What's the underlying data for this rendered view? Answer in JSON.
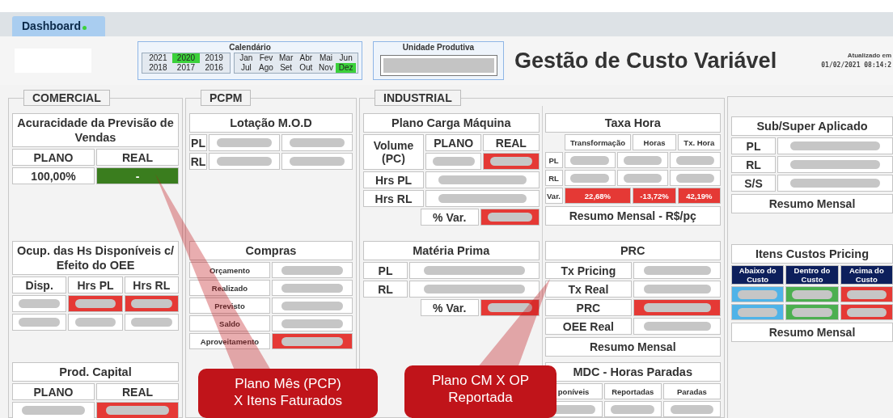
{
  "tab": {
    "label": "Dashboard",
    "selected": true
  },
  "calendar": {
    "title": "Calendário",
    "years": [
      {
        "label": "2021",
        "selected": false
      },
      {
        "label": "2020",
        "selected": true
      },
      {
        "label": "2019",
        "selected": false
      },
      {
        "label": "2018",
        "selected": false
      },
      {
        "label": "2017",
        "selected": false
      },
      {
        "label": "2016",
        "selected": false
      }
    ],
    "months": [
      {
        "label": "Jan",
        "selected": false
      },
      {
        "label": "Fev",
        "selected": false
      },
      {
        "label": "Mar",
        "selected": false
      },
      {
        "label": "Abr",
        "selected": false
      },
      {
        "label": "Mai",
        "selected": false
      },
      {
        "label": "Jun",
        "selected": false
      },
      {
        "label": "Jul",
        "selected": false
      },
      {
        "label": "Ago",
        "selected": false
      },
      {
        "label": "Set",
        "selected": false
      },
      {
        "label": "Out",
        "selected": false
      },
      {
        "label": "Nov",
        "selected": false
      },
      {
        "label": "Dez",
        "selected": true
      }
    ]
  },
  "unit": {
    "title": "Unidade Produtiva"
  },
  "title": "Gestão de Custo Variável",
  "updated": {
    "label": "Atualizado em",
    "value": "01/02/2021 08:14:2"
  },
  "sections": [
    {
      "title": "COMERCIAL",
      "columns": [
        [
          {
            "title": "Acuracidade da Previsão de Vendas",
            "kind": "standard",
            "rows": [
              [
                {
                  "text": "PLANO"
                },
                {
                  "text": "REAL"
                }
              ],
              [
                {
                  "text": "100,00%"
                },
                {
                  "text": "-",
                  "color": "#3a7d1e"
                }
              ]
            ]
          },
          {
            "title": "Ocup. das Hs Disponíveis c/ Efeito do OEE",
            "kind": "standard",
            "rows": [
              [
                {
                  "text": "Disp."
                },
                {
                  "text": "Hrs PL"
                },
                {
                  "text": "Hrs RL"
                }
              ],
              [
                {
                  "kind": "redacted"
                },
                {
                  "kind": "redacted",
                  "color": "#e53935"
                },
                {
                  "kind": "redacted",
                  "color": "#e53935"
                }
              ],
              [
                {
                  "kind": "redacted"
                },
                {
                  "kind": "redacted"
                },
                {
                  "kind": "redacted"
                }
              ]
            ]
          },
          {
            "title": "Prod. Capital",
            "kind": "standard",
            "rows": [
              [
                {
                  "text": "PLANO"
                },
                {
                  "text": "REAL"
                }
              ],
              [
                {
                  "kind": "redacted"
                },
                {
                  "kind": "redacted",
                  "color": "#e53935"
                }
              ]
            ]
          }
        ]
      ]
    },
    {
      "title": "PCPM",
      "columns": [
        [
          {
            "title": "Lotação M.O.D",
            "kind": "standard",
            "rows": [
              [
                {
                  "text": "PL",
                  "kind": "label"
                },
                {
                  "kind": "redacted"
                },
                {
                  "kind": "redacted"
                }
              ],
              [
                {
                  "text": "RL",
                  "kind": "label"
                },
                {
                  "kind": "redacted"
                },
                {
                  "kind": "redacted"
                }
              ]
            ]
          },
          {
            "title": "Compras",
            "kind": "compact",
            "rows": [
              [
                {
                  "text": "Orçamento"
                },
                {
                  "kind": "redacted"
                }
              ],
              [
                {
                  "text": "Realizado"
                },
                {
                  "kind": "redacted"
                }
              ],
              [
                {
                  "text": "Previsto"
                },
                {
                  "kind": "redacted"
                }
              ],
              [
                {
                  "text": "Saldo"
                },
                {
                  "kind": "redacted"
                }
              ],
              [
                {
                  "text": "Aproveitamento"
                },
                {
                  "kind": "redacted",
                  "color": "#e53935"
                }
              ]
            ]
          }
        ]
      ]
    },
    {
      "title": "INDUSTRIAL",
      "columns": [
        [
          {
            "title": "Plano Carga Máquina",
            "kind": "standard",
            "rows": [
              [
                {
                  "text": "Volume (PC)",
                  "kind": "wide-label"
                },
                {
                  "kind": "stack",
                  "rows": [
                    [
                      {
                        "text": "PLANO"
                      },
                      {
                        "text": "REAL"
                      }
                    ],
                    [
                      {
                        "kind": "redacted"
                      },
                      {
                        "kind": "redacted",
                        "color": "#e53935"
                      }
                    ]
                  ]
                }
              ],
              [
                {
                  "text": "Hrs PL",
                  "kind": "wide-label"
                },
                {
                  "kind": "redacted"
                }
              ],
              [
                {
                  "text": "Hrs RL",
                  "kind": "wide-label"
                },
                {
                  "kind": "redacted"
                }
              ],
              [
                {
                  "kind": "gap"
                },
                {
                  "text": "% Var."
                },
                {
                  "kind": "redacted",
                  "color": "#e53935"
                }
              ]
            ]
          },
          {
            "title": "Matéria Prima",
            "kind": "standard",
            "rows": [
              [
                {
                  "text": "PL",
                  "kind": "mid-label"
                },
                {
                  "kind": "redacted"
                }
              ],
              [
                {
                  "text": "RL",
                  "kind": "mid-label"
                },
                {
                  "kind": "redacted"
                }
              ],
              [
                {
                  "kind": "gap"
                },
                {
                  "text": "% Var."
                },
                {
                  "kind": "redacted",
                  "color": "#e53935"
                }
              ]
            ]
          }
        ],
        [
          {
            "title": "Taxa Hora",
            "kind": "compact",
            "rows": [
              [
                {
                  "kind": "blank"
                },
                {
                  "text": "Transformação",
                  "kind": "wide"
                },
                {
                  "text": "Horas"
                },
                {
                  "text": "Tx. Hora"
                }
              ],
              [
                {
                  "text": "PL",
                  "kind": "label"
                },
                {
                  "kind": "redacted"
                },
                {
                  "kind": "redacted"
                },
                {
                  "kind": "redacted"
                }
              ],
              [
                {
                  "text": "RL",
                  "kind": "label"
                },
                {
                  "kind": "redacted"
                },
                {
                  "kind": "redacted"
                },
                {
                  "kind": "redacted"
                }
              ],
              [
                {
                  "text": "Var.",
                  "kind": "label"
                },
                {
                  "text": "22,68%",
                  "kind": "wide",
                  "color": "#e53935"
                },
                {
                  "text": "-13,72%",
                  "color": "#e53935"
                },
                {
                  "text": "42,19%",
                  "color": "#e53935"
                }
              ]
            ],
            "buttons": [
              "Resumo Mensal - R$/pç"
            ]
          },
          {
            "title": "PRC",
            "kind": "standard",
            "rows": [
              [
                {
                  "text": "Tx Pricing"
                },
                {
                  "kind": "redacted"
                }
              ],
              [
                {
                  "text": "Tx Real"
                },
                {
                  "kind": "redacted"
                }
              ],
              [
                {
                  "text": "PRC"
                },
                {
                  "kind": "redacted",
                  "color": "#e53935"
                }
              ],
              [
                {
                  "text": "OEE Real"
                },
                {
                  "kind": "redacted"
                }
              ]
            ],
            "buttons": [
              "Resumo Mensal"
            ]
          },
          {
            "title": "MDC - Horas Paradas",
            "kind": "compact",
            "rows": [
              [
                {
                  "text": "poníveis"
                },
                {
                  "text": "Reportadas"
                },
                {
                  "text": "Paradas"
                }
              ],
              [
                {
                  "kind": "redacted"
                },
                {
                  "kind": "redacted"
                },
                {
                  "kind": "redacted"
                }
              ]
            ]
          }
        ]
      ]
    },
    {
      "columns": [
        [
          {
            "title": "Sub/Super Aplicado",
            "kind": "standard",
            "rows": [
              [
                {
                  "text": "PL",
                  "kind": "mid-label"
                },
                {
                  "kind": "redacted"
                }
              ],
              [
                {
                  "text": "RL",
                  "kind": "mid-label"
                },
                {
                  "kind": "redacted"
                }
              ],
              [
                {
                  "text": "S/S",
                  "kind": "mid-label"
                },
                {
                  "kind": "redacted"
                }
              ]
            ],
            "buttons": [
              "Resumo Mensal"
            ]
          },
          {
            "title": "Itens Custos Pricing",
            "kind": "compact",
            "rows": [
              [
                {
                  "text": "Abaixo do Custo",
                  "color": "#0d1f5c"
                },
                {
                  "text": "Dentro do Custo",
                  "color": "#0d1f5c"
                },
                {
                  "text": "Acima do Custo",
                  "color": "#0d1f5c"
                }
              ],
              [
                {
                  "kind": "redacted",
                  "color": "#4fb3e8"
                },
                {
                  "kind": "redacted",
                  "color": "#4caf50"
                },
                {
                  "kind": "redacted",
                  "color": "#e53935"
                }
              ],
              [
                {
                  "kind": "redacted",
                  "color": "#4fb3e8"
                },
                {
                  "kind": "redacted",
                  "color": "#4caf50"
                },
                {
                  "kind": "redacted",
                  "color": "#e53935"
                }
              ]
            ],
            "buttons": [
              "Resumo Mensal"
            ]
          }
        ]
      ]
    }
  ],
  "callouts": [
    {
      "lines": [
        "Plano Mês (PCP)",
        "X Itens Faturados"
      ]
    },
    {
      "lines": [
        "Plano CM X OP",
        "Reportada"
      ]
    }
  ]
}
